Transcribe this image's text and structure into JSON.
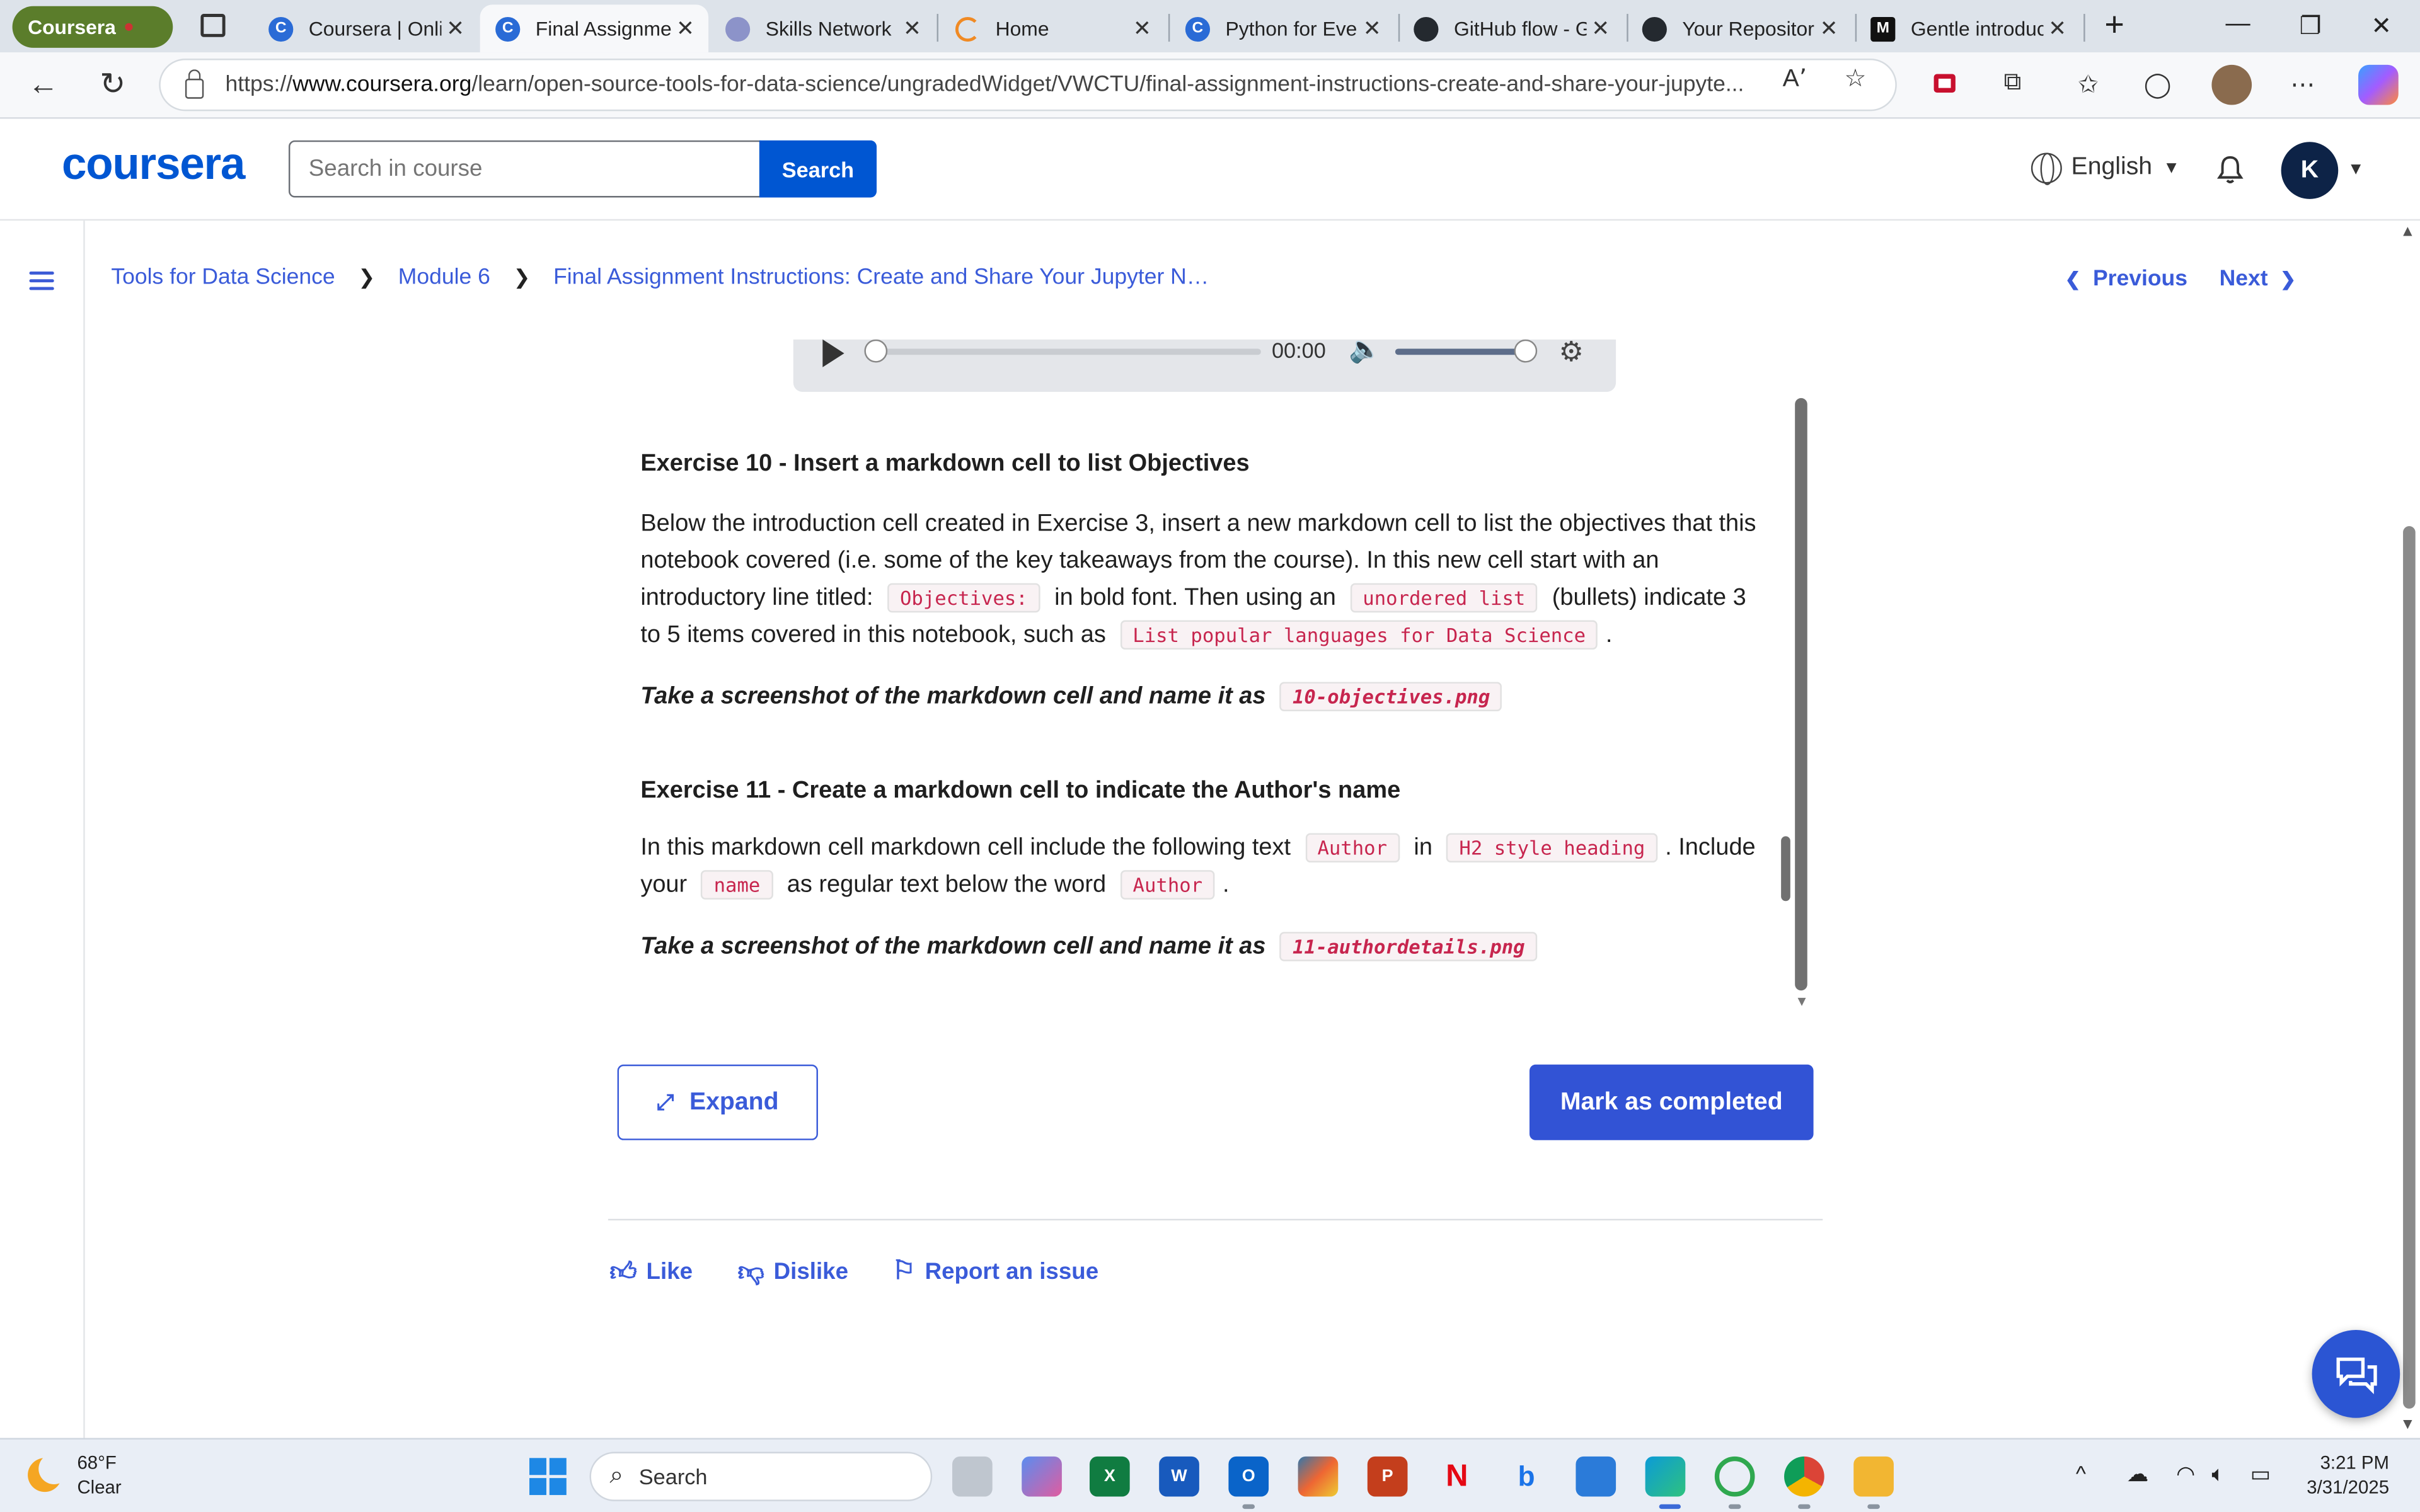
{
  "browser": {
    "tab_group": "Coursera",
    "tabs": [
      {
        "title": "Coursera | Online",
        "icon": "coursera-favicon"
      },
      {
        "title": "Final Assignment",
        "icon": "coursera-favicon",
        "active": true
      },
      {
        "title": "Skills Network L",
        "icon": "skills-network-favicon"
      },
      {
        "title": "Home",
        "icon": "loading-spinner"
      },
      {
        "title": "Python for Every",
        "icon": "coursera-favicon"
      },
      {
        "title": "GitHub flow - G",
        "icon": "github-favicon"
      },
      {
        "title": "Your Repositorie",
        "icon": "github-favicon"
      },
      {
        "title": "Gentle introduc",
        "icon": "medium-favicon"
      }
    ],
    "url_prefix": "https://",
    "url_host": "www.coursera.org",
    "url_path": "/learn/open-source-tools-for-data-science/ungradedWidget/VWCTU/final-assignment-instructions-create-and-share-your-jupyte..."
  },
  "header": {
    "logo": "coursera",
    "search_placeholder": "Search in course",
    "search_button": "Search",
    "language": "English",
    "avatar_initial": "K"
  },
  "breadcrumb": {
    "items": [
      "Tools for Data Science",
      "Module 6",
      "Final Assignment Instructions: Create and Share Your Jupyter N…"
    ],
    "previous": "Previous",
    "next": "Next"
  },
  "audio": {
    "time": "00:00"
  },
  "content": {
    "ex10": {
      "title": "Exercise 10 - Insert a markdown cell to list Objectives",
      "p1": "Below the introduction cell created in Exercise 3, insert a new markdown cell to list the objectives that this notebook covered (i.e. some of the key takeaways from the course). In this new cell start with an introductory line titled:",
      "code1": "Objectives:",
      "p2": "in bold font. Then using an",
      "code2": "unordered list",
      "p3": "(bullets) indicate 3 to 5 items covered in this notebook, such as",
      "code3": "List popular languages for Data Science",
      "p4": ".",
      "shot_text": "Take a screenshot of the markdown cell and name it as",
      "shot_file": "10-objectives.png"
    },
    "ex11": {
      "title": "Exercise 11 - Create a markdown cell to indicate the Author's name",
      "p1": "In this markdown cell markdown cell include the following text",
      "code1": "Author",
      "p2": "in",
      "code2": "H2 style heading",
      "p3": ". Include your",
      "code3": "name",
      "p4": "as regular text below the word",
      "code4": "Author",
      "p5": ".",
      "shot_text": "Take a screenshot of the markdown cell and name it as",
      "shot_file": "11-authordetails.png"
    }
  },
  "actions": {
    "expand": "Expand",
    "mark_completed": "Mark as completed",
    "like": "Like",
    "dislike": "Dislike",
    "report": "Report an issue"
  },
  "taskbar": {
    "temperature": "68°F",
    "condition": "Clear",
    "search": "Search",
    "time": "3:21 PM",
    "date": "3/31/2025"
  },
  "colors": {
    "coursera_blue": "#0056d2",
    "link_blue": "#3a5bd9",
    "primary_button": "#3253d5",
    "code_text": "#c7254e"
  }
}
